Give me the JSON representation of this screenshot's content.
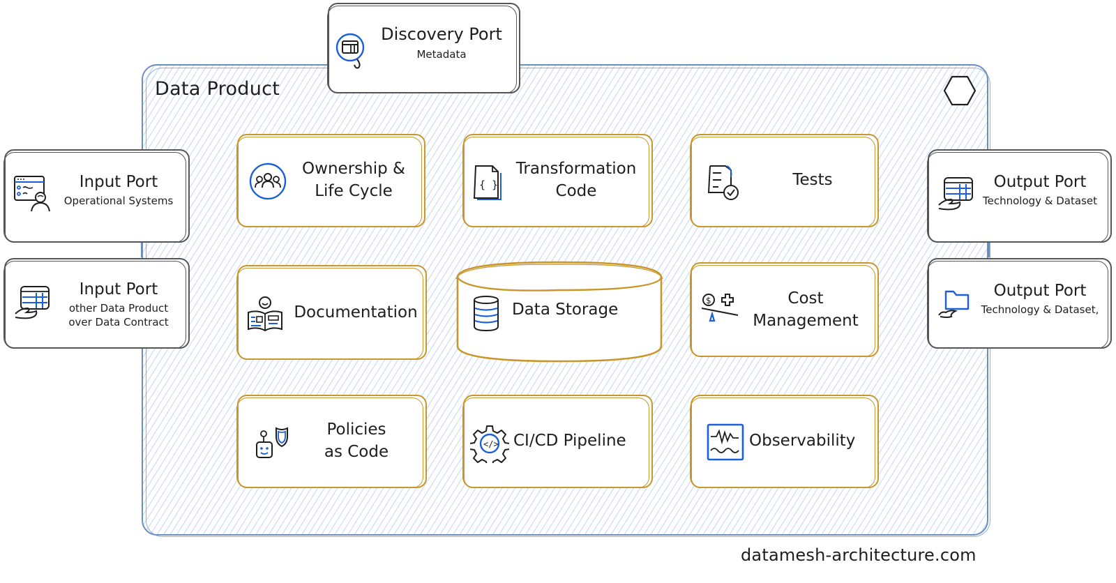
{
  "container": {
    "title": "Data Product",
    "border_color": "#6c8ebf",
    "hatch_color": "#a5c4f0"
  },
  "discovery_port": {
    "title": "Discovery Port",
    "subtitle": "Metadata",
    "icon": "magnifier-window-icon"
  },
  "input_ports": [
    {
      "title": "Input Port",
      "subtitle": "Operational Systems",
      "icon": "operator-dashboard-icon"
    },
    {
      "title": "Input Port",
      "subtitle": "other Data Product\nover Data Contract",
      "icon": "hand-table-icon"
    }
  ],
  "output_ports": [
    {
      "title": "Output Port",
      "subtitle": "Technology & Dataset",
      "icon": "hand-table-icon"
    },
    {
      "title": "Output Port",
      "subtitle": "Technology & Dataset,",
      "icon": "hand-folder-icon"
    }
  ],
  "components": [
    {
      "label": "Ownership &\nLife Cycle",
      "icon": "team-icon"
    },
    {
      "label": "Transformation\nCode",
      "icon": "code-file-icon"
    },
    {
      "label": "Tests",
      "icon": "test-checklist-icon"
    },
    {
      "label": "Documentation",
      "icon": "reading-person-icon"
    },
    {
      "label": "Data Storage",
      "icon": "database-icon"
    },
    {
      "label": "Cost\nManagement",
      "icon": "cost-scale-icon"
    },
    {
      "label": "Policies\nas Code",
      "icon": "robot-shield-icon"
    },
    {
      "label": "CI/CD Pipeline",
      "icon": "gear-code-icon"
    },
    {
      "label": "Observability",
      "icon": "signal-monitor-icon"
    }
  ],
  "colors": {
    "component_border": "#c8962a",
    "port_border": "#555555",
    "icon_accent": "#1a5fd8",
    "text": "#1e1e1e"
  },
  "footer": {
    "text": "datamesh-architecture.com"
  }
}
